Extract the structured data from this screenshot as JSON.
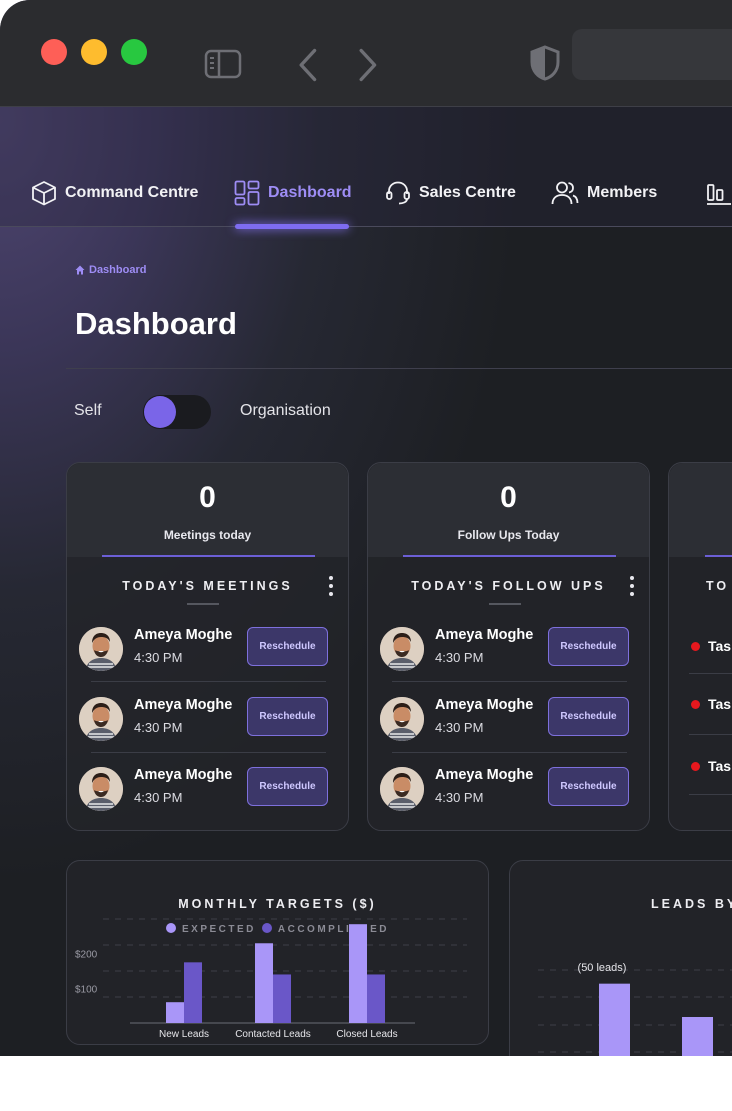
{
  "browser": {
    "traffic_lights": {
      "close": "#fe5f57",
      "minimize": "#febc2e",
      "zoom": "#28c840"
    },
    "icons": [
      "sidebar-toggle-icon",
      "back-chevron-icon",
      "forward-chevron-icon",
      "shield-icon"
    ]
  },
  "nav": {
    "items": [
      {
        "label": "Command Centre",
        "icon": "cube-icon"
      },
      {
        "label": "Dashboard",
        "icon": "dashboard-grid-icon",
        "active": true
      },
      {
        "label": "Sales Centre",
        "icon": "headset-icon"
      },
      {
        "label": "Members",
        "icon": "users-icon"
      },
      {
        "label": "",
        "icon": "bar-chart-icon"
      }
    ]
  },
  "breadcrumb": {
    "icon": "home-icon",
    "label": "Dashboard"
  },
  "page": {
    "title": "Dashboard"
  },
  "scope_toggle": {
    "left_label": "Self",
    "right_label": "Organisation",
    "selected": "Self"
  },
  "cards": [
    {
      "stat_value": "0",
      "stat_label": "Meetings today",
      "section_title": "TODAY'S MEETINGS",
      "rows": [
        {
          "name": "Ameya Moghe",
          "time": "4:30 PM",
          "action": "Reschedule"
        },
        {
          "name": "Ameya Moghe",
          "time": "4:30 PM",
          "action": "Reschedule"
        },
        {
          "name": "Ameya Moghe",
          "time": "4:30 PM",
          "action": "Reschedule"
        }
      ]
    },
    {
      "stat_value": "0",
      "stat_label": "Follow Ups Today",
      "section_title": "TODAY'S FOLLOW UPS",
      "rows": [
        {
          "name": "Ameya Moghe",
          "time": "4:30 PM",
          "action": "Reschedule"
        },
        {
          "name": "Ameya Moghe",
          "time": "4:30 PM",
          "action": "Reschedule"
        },
        {
          "name": "Ameya Moghe",
          "time": "4:30 PM",
          "action": "Reschedule"
        }
      ]
    },
    {
      "section_title": "TO",
      "tasks": [
        "Tas",
        "Tas",
        "Tas"
      ]
    }
  ],
  "colors": {
    "accent": "#7e6cf0",
    "accent_light": "#9e8df5",
    "expected": "#a996f8",
    "accomplished": "#6a57c8",
    "task_dot": "#e6181e"
  },
  "chart_data": [
    {
      "type": "bar",
      "title": "MONTHLY TARGETS ($)",
      "legend": [
        "EXPECTED",
        "ACCOMPLISHED"
      ],
      "categories": [
        "New Leads",
        "Contacted Leads",
        "Closed Leads"
      ],
      "series": [
        {
          "name": "EXPECTED",
          "values": [
            60,
            230,
            285
          ]
        },
        {
          "name": "ACCOMPLISHED",
          "values": [
            175,
            140,
            140
          ]
        }
      ],
      "yticks": [
        "$200",
        "$100"
      ],
      "ytick_values": [
        200,
        100
      ],
      "ylim": [
        0,
        300
      ],
      "grid": true
    },
    {
      "type": "bar",
      "title": "LEADS BY",
      "annotation": "(50 leads)",
      "values": [
        50,
        30
      ],
      "ylim": [
        0,
        60
      ],
      "grid": true
    }
  ]
}
